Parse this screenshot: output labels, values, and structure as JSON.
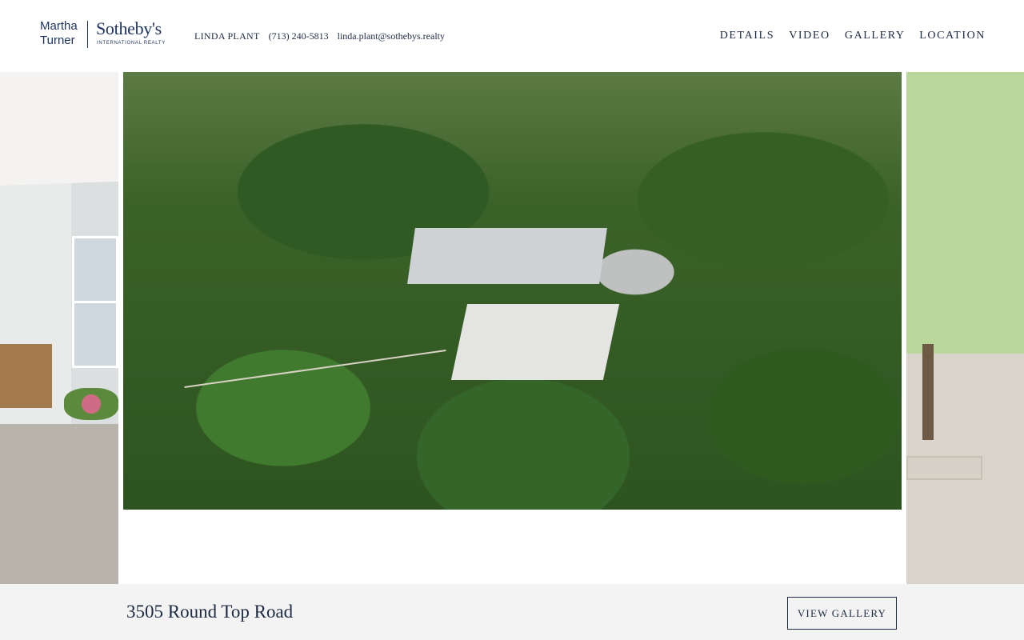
{
  "header": {
    "logo": {
      "line1": "Martha",
      "line2": "Turner",
      "brand": "Sotheby's",
      "subtitle": "INTERNATIONAL REALTY"
    },
    "contact": {
      "name": "LINDA PLANT",
      "phone": "(713) 240-5813",
      "email": "linda.plant@sothebys.realty"
    },
    "nav": [
      {
        "label": "DETAILS"
      },
      {
        "label": "VIDEO"
      },
      {
        "label": "GALLERY"
      },
      {
        "label": "LOCATION"
      }
    ]
  },
  "gallery": {
    "slides": [
      {
        "subject": "house-porch-photo",
        "position": "previous"
      },
      {
        "subject": "aerial-property-photo",
        "position": "current"
      },
      {
        "subject": "garden-trees-photo",
        "position": "next"
      }
    ]
  },
  "listing": {
    "address": "3505 Round Top Road",
    "view_gallery_label": "VIEW GALLERY"
  },
  "colors": {
    "brand_navy": "#1f3561",
    "text": "#1d2a44",
    "bottom_bar": "#f3f3f3"
  }
}
